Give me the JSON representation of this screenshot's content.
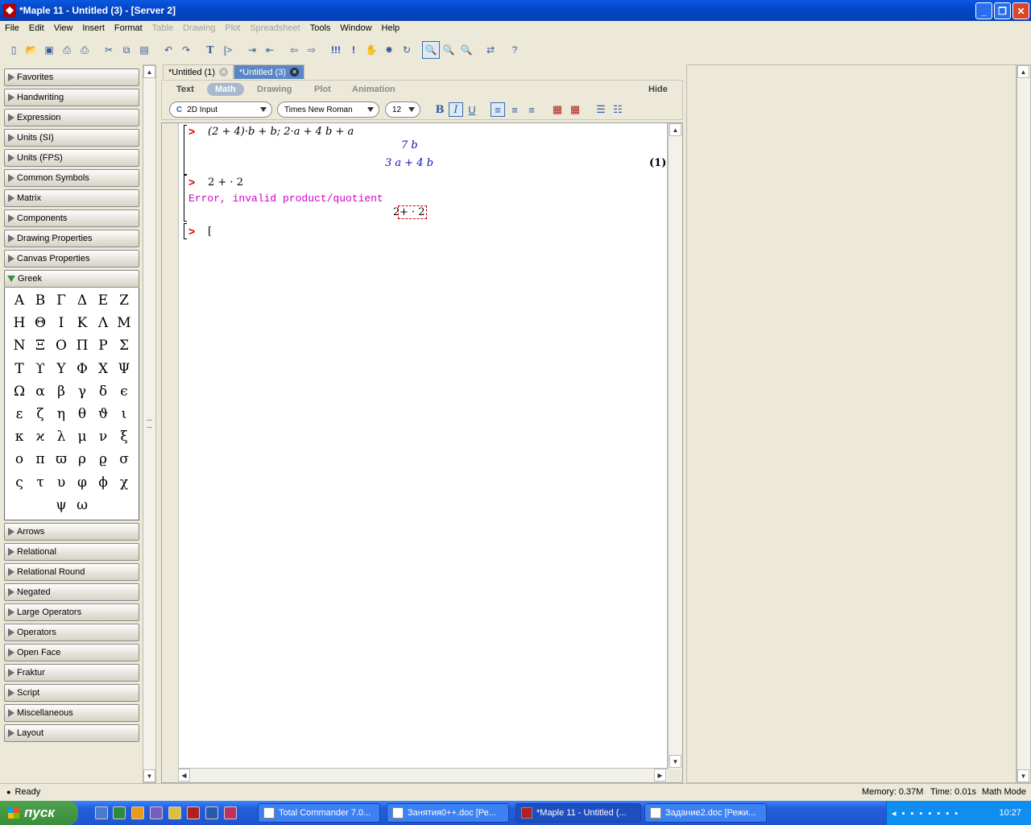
{
  "window": {
    "title": "*Maple 11 - Untitled (3) - [Server 2]"
  },
  "menu": [
    "File",
    "Edit",
    "View",
    "Insert",
    "Format",
    "Table",
    "Drawing",
    "Plot",
    "Spreadsheet",
    "Tools",
    "Window",
    "Help"
  ],
  "menu_disabled": [
    "Table",
    "Drawing",
    "Plot",
    "Spreadsheet"
  ],
  "palettes_top": [
    "Favorites",
    "Handwriting",
    "Expression",
    "Units (SI)",
    "Units (FPS)",
    "Common Symbols",
    "Matrix",
    "Components",
    "Drawing Properties",
    "Canvas Properties"
  ],
  "greek": {
    "label": "Greek",
    "symbols": [
      "Α",
      "Β",
      "Γ",
      "Δ",
      "Ε",
      "Ζ",
      "Η",
      "Θ",
      "Ι",
      "Κ",
      "Λ",
      "Μ",
      "Ν",
      "Ξ",
      "Ο",
      "Π",
      "Ρ",
      "Σ",
      "Τ",
      "ϒ",
      "Υ",
      "Φ",
      "Χ",
      "Ψ",
      "Ω",
      "α",
      "β",
      "γ",
      "δ",
      "ϵ",
      "ε",
      "ζ",
      "η",
      "θ",
      "ϑ",
      "ι",
      "κ",
      "ϰ",
      "λ",
      "μ",
      "ν",
      "ξ",
      "ο",
      "π",
      "ϖ",
      "ρ",
      "ϱ",
      "σ",
      "ς",
      "τ",
      "υ",
      "φ",
      "ϕ",
      "χ",
      "ψ",
      "ω"
    ]
  },
  "palettes_bottom": [
    "Arrows",
    "Relational",
    "Relational Round",
    "Negated",
    "Large Operators",
    "Operators",
    "Open Face",
    "Fraktur",
    "Script",
    "Miscellaneous",
    "Layout"
  ],
  "tabs": [
    {
      "label": "*Untitled (1)"
    },
    {
      "label": "*Untitled (3)"
    }
  ],
  "context_bar": {
    "modes": [
      "Text",
      "Math",
      "Drawing",
      "Plot",
      "Animation"
    ],
    "active_mode": "Math",
    "hide": "Hide",
    "input_mode": "2D Input",
    "input_mode_icon": "C",
    "font": "Times New Roman",
    "size": "12",
    "bold": "B",
    "italic": "I",
    "underline": "U"
  },
  "worksheet": {
    "input1": "(2 + 4)·b + b; 2·a + 4 b + a",
    "output1a": "7 b",
    "output1b": "3 a + 4 b",
    "label1": "(1)",
    "input2": "2 + · 2",
    "error": "Error, invalid product/quotient",
    "error_expr_left": "2",
    "error_expr_box": "+ · 2",
    "prompt": ">",
    "cursor": "["
  },
  "status": {
    "state": "Ready",
    "memory": "Memory: 0.37M",
    "time": "Time: 0.01s",
    "mode": "Math Mode"
  },
  "taskbar": {
    "start": "пуск",
    "tasks": [
      "Total Commander 7.0...",
      "Занятия0++.doc [Ре...",
      "*Maple 11 - Untitled (...",
      "Задание2.doc [Режи..."
    ],
    "clock": "10:27"
  }
}
